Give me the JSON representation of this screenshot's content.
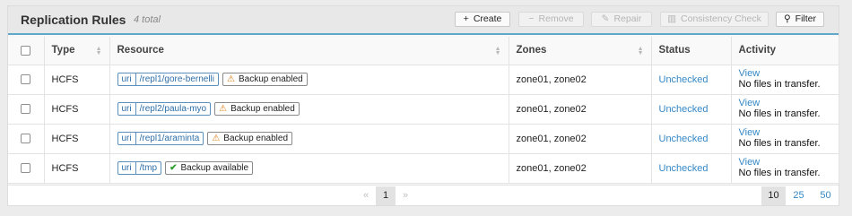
{
  "header": {
    "title": "Replication Rules",
    "count": "4 total",
    "buttons": {
      "create": {
        "icon": "+",
        "label": "Create"
      },
      "remove": {
        "icon": "−",
        "label": "Remove"
      },
      "repair": {
        "icon": "✎",
        "label": "Repair"
      },
      "consistency": {
        "icon": "▥",
        "label": "Consistency Check"
      },
      "filter": {
        "icon": "⚲",
        "label": "Filter"
      }
    }
  },
  "columns": {
    "type": "Type",
    "resource": "Resource",
    "zones": "Zones",
    "status": "Status",
    "activity": "Activity"
  },
  "rows": [
    {
      "type": "HCFS",
      "uri_key": "uri",
      "uri": "/repl1/gore-bernelli",
      "badge": "Backup enabled",
      "badge_icon": "warning",
      "zones": "zone01, zone02",
      "status": "Unchecked",
      "view": "View",
      "activity": "No files in transfer."
    },
    {
      "type": "HCFS",
      "uri_key": "uri",
      "uri": "/repl2/paula-myo",
      "badge": "Backup enabled",
      "badge_icon": "warning",
      "zones": "zone01, zone02",
      "status": "Unchecked",
      "view": "View",
      "activity": "No files in transfer."
    },
    {
      "type": "HCFS",
      "uri_key": "uri",
      "uri": "/repl1/araminta",
      "badge": "Backup enabled",
      "badge_icon": "warning",
      "zones": "zone01, zone02",
      "status": "Unchecked",
      "view": "View",
      "activity": "No files in transfer."
    },
    {
      "type": "HCFS",
      "uri_key": "uri",
      "uri": "/tmp",
      "badge": "Backup available",
      "badge_icon": "check",
      "zones": "zone01, zone02",
      "status": "Unchecked",
      "view": "View",
      "activity": "No files in transfer."
    }
  ],
  "pagination": {
    "prev": "«",
    "current": "1",
    "next": "»",
    "page_sizes": [
      "10",
      "25",
      "50"
    ],
    "selected_size": "10"
  },
  "colors": {
    "accent": "#3588c6",
    "warning": "#e07b10",
    "success": "#2d9e2d",
    "header_border": "#5fa8c9"
  }
}
